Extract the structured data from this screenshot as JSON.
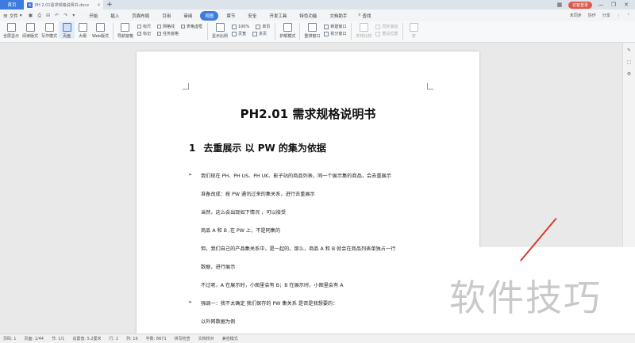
{
  "tabbar": {
    "home_label": "首页",
    "doc_icon": "W",
    "doc_title": "PH 2.01需求规格说明书.docx",
    "login_label": "访客登录"
  },
  "menubar": {
    "file_label": "文件",
    "items": [
      {
        "label": "开始"
      },
      {
        "label": "插入"
      },
      {
        "label": "页面布局"
      },
      {
        "label": "引用"
      },
      {
        "label": "审阅"
      },
      {
        "label": "视图"
      },
      {
        "label": "章节"
      },
      {
        "label": "安全"
      },
      {
        "label": "开发工具"
      },
      {
        "label": "特色功能"
      },
      {
        "label": "文档助手"
      }
    ],
    "search_label": "查找",
    "right": [
      "未同步",
      "协作",
      "分享"
    ]
  },
  "ribbon": {
    "view_buttons": [
      "全屏显示",
      "阅读版式",
      "写作模式",
      "页面",
      "大纲",
      "Web版式"
    ],
    "nav_label": "导航窗格",
    "checks_row1": [
      "标尺",
      "网格线",
      "表格虚框"
    ],
    "checks_row2": [
      "标记",
      "任务窗格"
    ],
    "display_label": "显示比例",
    "zoom_value": "100%",
    "single_page": "单页",
    "page_width": "页宽",
    "multi_page": "多页",
    "eye_label": "护眼模式",
    "rearrange": "重排窗口",
    "new_window": "新建窗口",
    "split_window": "拆分窗口",
    "sync_scroll": "并排比较",
    "sync_roll": "同步滚动",
    "reset_pos": "重设位置",
    "macro": "宏"
  },
  "document": {
    "title": "PH2.01 需求规格说明书",
    "heading_num": "1",
    "heading": "去重展示 以 PW 的集为依据",
    "lines": [
      {
        "text": "我们现在 PH、PH US、PH UK、影子站的商品列表，同一个展示集的商品，会去重展示",
        "bullet": true
      },
      {
        "text": "准备改成：按 PW 通讯过来的集关系，进行去重展示",
        "bullet": false
      },
      {
        "text": "当然，这么会出现如下情况 ，可以接受",
        "bullet": false
      },
      {
        "text": "商品 A 和 B ,在 PW 上，不是同集的",
        "bullet": false
      },
      {
        "text": "但，我们自己的产品集关系中，是一起的。那么，商品 A 和 B 就会在商品列表单独占一行",
        "bullet": false
      },
      {
        "text": "数据，进行展示",
        "bullet": false
      },
      {
        "text": "不过呢，A 在展示时，小图里会有 B；B 在展示时，小图里会有 A",
        "bullet": false
      },
      {
        "text": "强调一：我不太确定 我们保存的 PW 集关系 是否是我想要的：",
        "bullet": true
      },
      {
        "text": "以外网数据为例",
        "bullet": false
      }
    ]
  },
  "watermark": "软件技巧",
  "statusbar": [
    "页码: 1",
    "页面: 1/44",
    "节: 1/1",
    "设置值: 5.2厘米",
    "行: 2",
    "列: 16",
    "字数: 8671",
    "拼写检查",
    "文档校对",
    "兼容模式"
  ],
  "colors": {
    "accent": "#3c7be0",
    "login": "#e0574b"
  }
}
